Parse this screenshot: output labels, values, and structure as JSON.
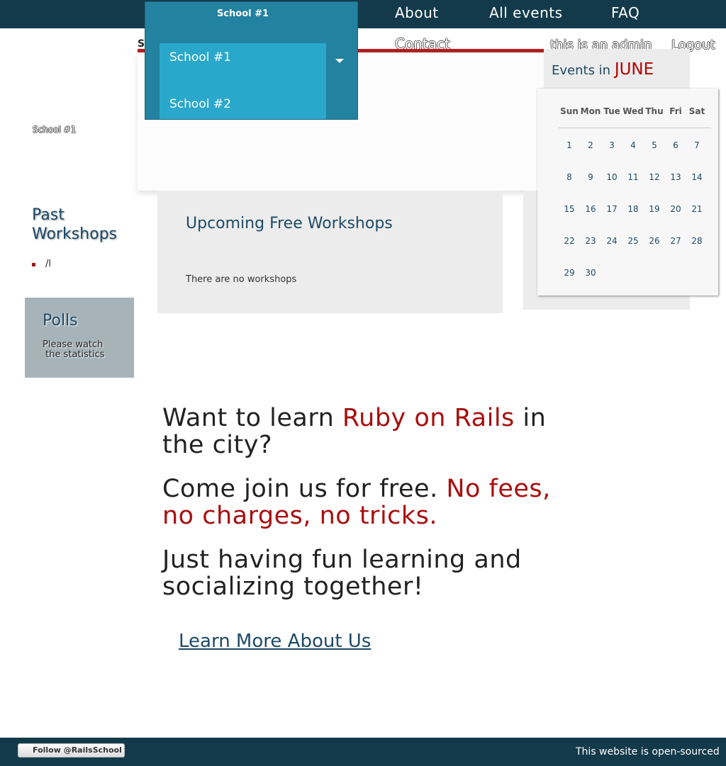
{
  "nav": {
    "links": [
      "About",
      "All events",
      "FAQ"
    ],
    "contact": "Contact",
    "admin": "this is an admin",
    "logout": "Logout",
    "si_fragment": "Si"
  },
  "dropdown": {
    "title": "School #1",
    "options": [
      "School #1",
      "School #2"
    ]
  },
  "sidebar": {
    "school_label": "School #1",
    "past_title": "Past Workshops",
    "past_items": [
      "/l"
    ],
    "polls_title": "Polls",
    "polls_text": "Please watch the statistics"
  },
  "workshops": {
    "title": "Upcoming Free Workshops",
    "empty": "There are no workshops"
  },
  "events": {
    "prefix": "Events in",
    "month": "JUNE",
    "day_names": [
      "Sun",
      "Mon",
      "Tue",
      "Wed",
      "Thu",
      "Fri",
      "Sat"
    ],
    "weeks": [
      [
        "1",
        "2",
        "3",
        "4",
        "5",
        "6",
        "7"
      ],
      [
        "8",
        "9",
        "10",
        "11",
        "12",
        "13",
        "14"
      ],
      [
        "15",
        "16",
        "17",
        "18",
        "19",
        "20",
        "21"
      ],
      [
        "22",
        "23",
        "24",
        "25",
        "26",
        "27",
        "28"
      ],
      [
        "29",
        "30"
      ]
    ]
  },
  "hero": {
    "line1_a": "Want to learn ",
    "line1_b": "Ruby on Rails",
    "line1_c": " in the city?",
    "line2_a": "Come join us for free. ",
    "line2_b": "No fees, no charges, no tricks.",
    "line3": "Just having fun learning and socializing together!",
    "learn_more": "Learn More About Us"
  },
  "footer": {
    "follow": "Follow @RailsSchool",
    "opensource": "This website is open-sourced"
  },
  "colors": {
    "nav_bg": "#133a4a",
    "accent_red": "#a80f0f",
    "dropdown_bg": "#23829f",
    "dropdown_list": "#29a8cc"
  }
}
